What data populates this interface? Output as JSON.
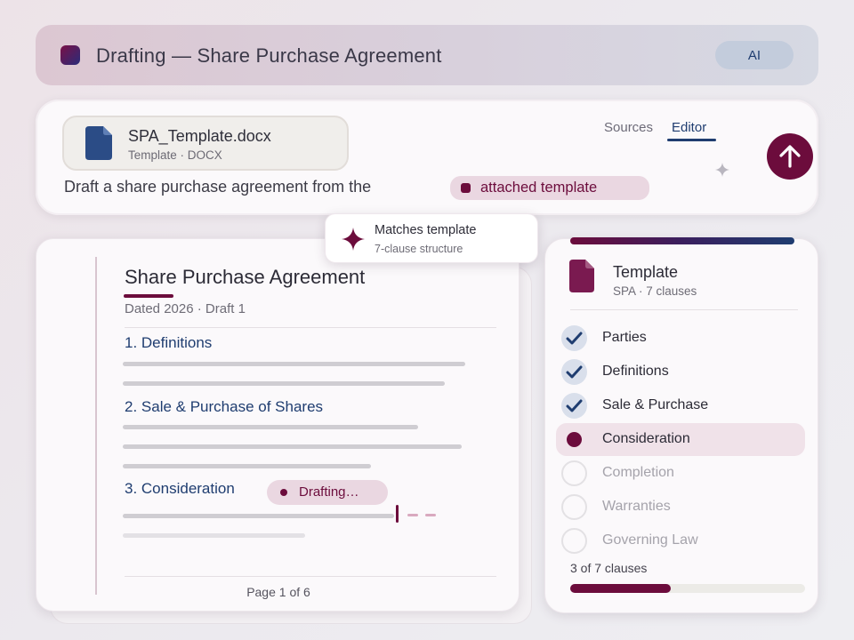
{
  "header": {
    "title": "Drafting — Share Purchase Agreement",
    "badge": "AI"
  },
  "prompt": {
    "file": {
      "name": "SPA_Template.docx",
      "meta": "Template · DOCX",
      "icon": "document-icon",
      "color": "#2b4c86"
    },
    "tabs": [
      {
        "label": "Sources",
        "active": false
      },
      {
        "label": "Editor",
        "active": true
      }
    ],
    "text": "Draft a share purchase agreement from the",
    "chip": "attached template",
    "send_icon": "arrow-up-icon"
  },
  "tooltip": {
    "title": "Matches template",
    "subtitle": "7-clause structure",
    "icon": "sparkle-icon"
  },
  "document": {
    "title": "Share Purchase Agreement",
    "dated": "Dated 2026 · Draft 1",
    "sections": [
      {
        "heading": "1. Definitions"
      },
      {
        "heading": "2. Sale & Purchase of Shares"
      },
      {
        "heading": "3. Consideration"
      }
    ],
    "status_chip": "Drafting…",
    "page": "Page 1 of 6"
  },
  "template_panel": {
    "title": "Template",
    "subtitle": "SPA · 7 clauses",
    "clauses": [
      {
        "label": "Parties",
        "state": "done"
      },
      {
        "label": "Definitions",
        "state": "done"
      },
      {
        "label": "Sale & Purchase",
        "state": "done"
      },
      {
        "label": "Consideration",
        "state": "current"
      },
      {
        "label": "Completion",
        "state": "pending"
      },
      {
        "label": "Warranties",
        "state": "pending"
      },
      {
        "label": "Governing Law",
        "state": "pending"
      }
    ],
    "progress_text": "3 of 7 clauses",
    "progress_fraction": 0.4286
  },
  "colors": {
    "accent": "#6c0c3c",
    "navy": "#1f3d70"
  }
}
